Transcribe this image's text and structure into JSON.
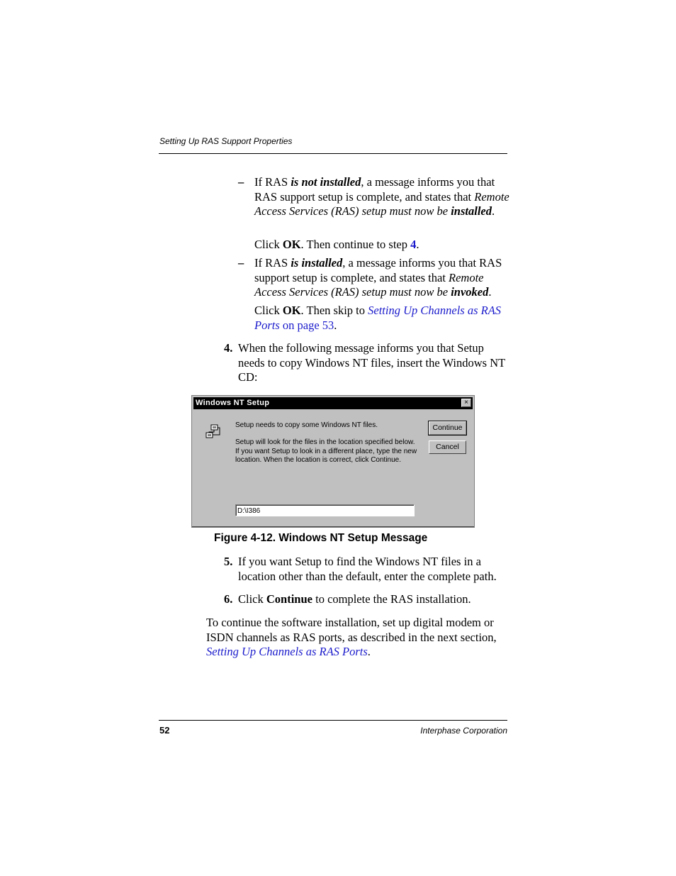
{
  "header": {
    "running_title": "Setting Up RAS Support Properties"
  },
  "substeps": [
    {
      "marker": "–",
      "text_1": "If RAS ",
      "emph": "is not installed",
      "text_2": ", a message informs you that RAS support setup is complete, and states that ",
      "italic_msg": "Remote Access Services (RAS) setup must now be ",
      "italic_bold": "installed",
      "text_3": ".",
      "click_1": "Click ",
      "click_bold": "OK",
      "click_2": ". Then continue to step ",
      "step_link": "4",
      "click_3": "."
    },
    {
      "marker": "–",
      "text_1": "If RAS ",
      "emph": "is installed",
      "text_2": ", a message informs you that RAS support setup is complete, and states that ",
      "italic_msg": "Remote Access Services (RAS) setup must now be ",
      "italic_bold": "invoked",
      "text_3": ".",
      "click_1": "Click ",
      "click_bold": "OK",
      "click_2": ". Then skip to ",
      "xref_link": "Setting Up Channels as RAS Ports",
      "xref_page": " on page 53",
      "click_3": "."
    }
  ],
  "steps": [
    {
      "number": "4.",
      "text": "When the following message informs you that Setup needs to copy Windows NT files, insert the Windows NT CD:"
    },
    {
      "number": "5.",
      "text": "If you want Setup to find the Windows NT files in a location other than the default, enter the complete path."
    },
    {
      "number": "6.",
      "text_1": "Click ",
      "bold": "Continue",
      "text_2": " to complete the RAS installation."
    }
  ],
  "dialog": {
    "title": "Windows NT Setup",
    "close_glyph": "×",
    "icon": "network-setup-icon",
    "line1": "Setup needs to copy some Windows NT files.",
    "line2": "Setup will look for the files in the location specified below. If you want Setup to look in a different place, type the new location. When the location is correct, click Continue.",
    "continue_label": "Continue",
    "cancel_label": "Cancel",
    "path_value": "D:\\I386"
  },
  "figure": {
    "caption": "Figure 4-12.  Windows NT Setup Message"
  },
  "closing": {
    "text": "To continue the software installation, set up digital modem or ISDN channels as RAS ports, as described in the next section, ",
    "link": "Setting Up Channels as RAS Ports",
    "end": "."
  },
  "footer": {
    "page_number": "52",
    "company": "Interphase Corporation"
  },
  "colors": {
    "link": "#1a1acc",
    "dialog_face": "#c0c0c0",
    "titlebar": "#000000"
  }
}
